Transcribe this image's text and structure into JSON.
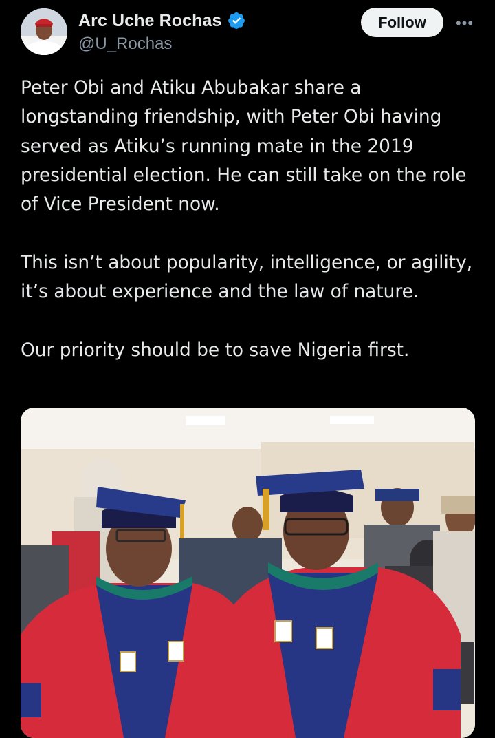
{
  "post": {
    "author": {
      "display_name": "Arc Uche Rochas",
      "handle": "@U_Rochas",
      "verified": true,
      "avatar_icon": "avatar-photo"
    },
    "follow_label": "Follow",
    "more_icon": "more-horizontal-icon",
    "more_glyph": "•••",
    "paragraphs": [
      "Peter Obi and Atiku Abubakar share a longstanding friendship, with Peter Obi having served as Atiku’s running mate in the 2019 presidential election. He can still take on the role of Vice President now.",
      "This isn’t about popularity, intelligence, or agility, it’s about experience and the law of nature.",
      "Our priority should be to save Nigeria first."
    ],
    "media": {
      "type": "photo",
      "alt_icon": "attached-photo"
    }
  },
  "colors": {
    "background": "#000000",
    "text_primary": "#e7e9ea",
    "text_secondary": "#8b98a5",
    "verified_blue": "#1d9bf0",
    "follow_bg": "#eff3f4"
  }
}
